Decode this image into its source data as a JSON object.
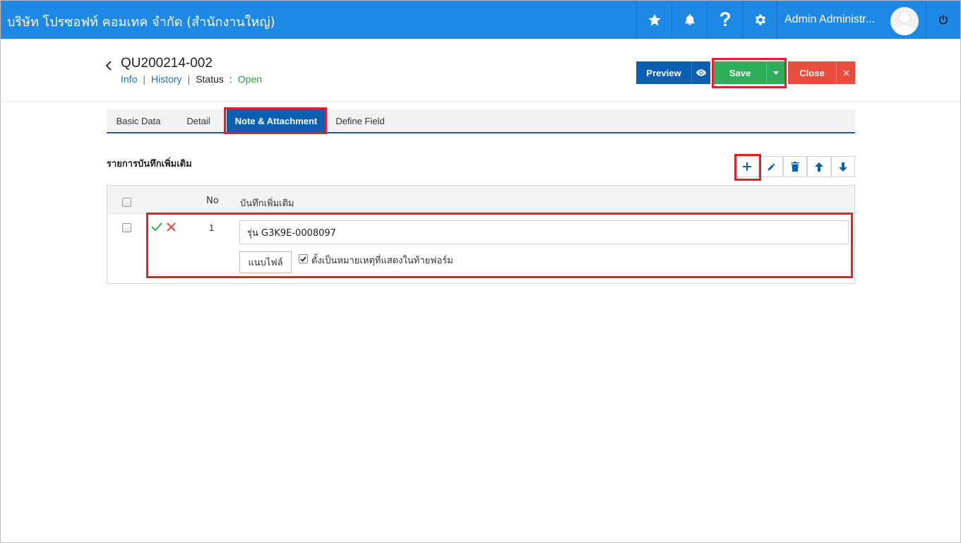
{
  "topbar": {
    "company": "บริษัท โปรซอฟท์ คอมเทค จำกัด (สำนักงานใหญ่)",
    "username": "Admin Administr...",
    "icons": [
      "star-icon",
      "bell-icon",
      "help-icon",
      "gear-icon",
      "power-icon"
    ],
    "color": "#1e88e5"
  },
  "header": {
    "doc_no": "QU200214-002",
    "info_link": "Info",
    "history_link": "History",
    "status_label": "Status",
    "status_sep": ":",
    "status_value": "Open",
    "separator": "|"
  },
  "actions": {
    "preview": "Preview",
    "save": "Save",
    "close": "Close"
  },
  "tabs": [
    {
      "label": "Basic Data"
    },
    {
      "label": "Detail"
    },
    {
      "label": "Note & Attachment",
      "active": true
    },
    {
      "label": "Define Field"
    }
  ],
  "notes": {
    "title": "รายการบันทึกเพิ่มเติม",
    "columns": {
      "no": "No",
      "note": "บันทึกเพิ่มเติม"
    },
    "rows": [
      {
        "no": "1",
        "value": "รุ่น G3K9E-0008097",
        "attach_label": "แนบไฟล์",
        "footer_checkbox_label": "ตั้งเป็นหมายเหตุที่แสดงในท้ายฟอร์ม",
        "footer_checked": true
      }
    ]
  }
}
